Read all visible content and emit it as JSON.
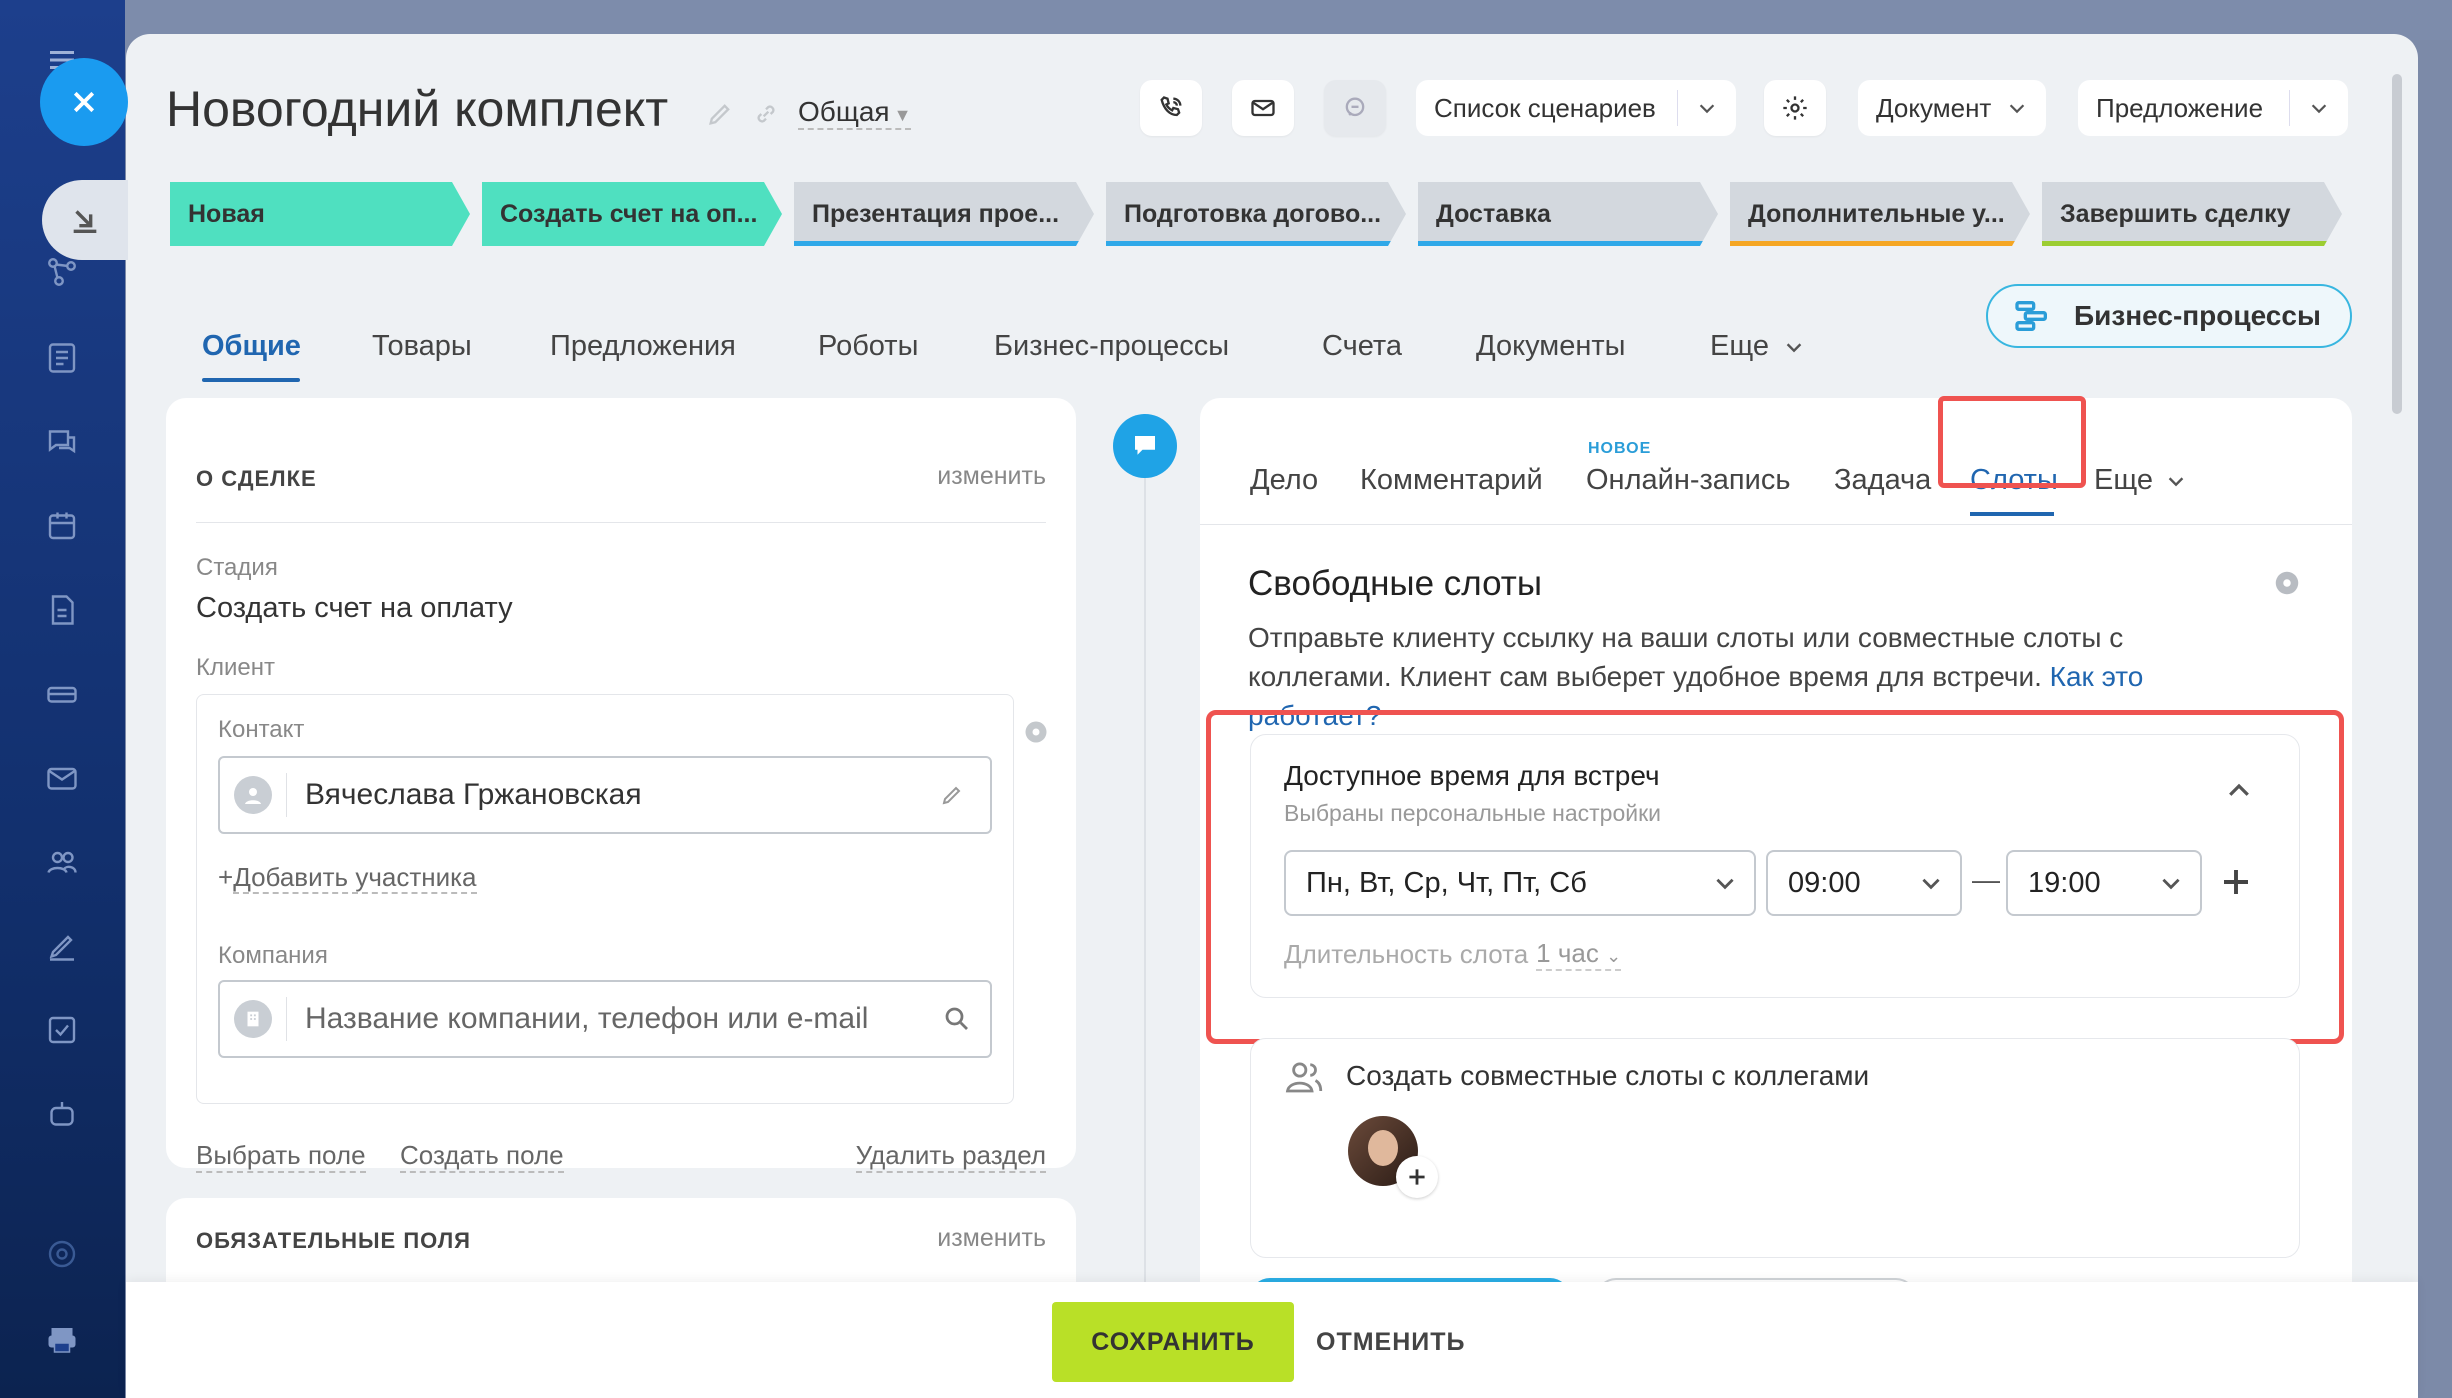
{
  "deal": {
    "title": "Новогодний комплект",
    "category": "Общая"
  },
  "header_buttons": {
    "scenarios": "Список сценариев",
    "document": "Документ",
    "proposal": "Предложение"
  },
  "stages": [
    {
      "label": "Новая",
      "state": "done",
      "color": "#4fe0c0"
    },
    {
      "label": "Создать счет на оп...",
      "state": "done",
      "color": "#4fe0c0"
    },
    {
      "label": "Презентация прое...",
      "state": "todo",
      "color": "#2fa8e8"
    },
    {
      "label": "Подготовка догово...",
      "state": "todo",
      "color": "#2fa8e8"
    },
    {
      "label": "Доставка",
      "state": "todo",
      "color": "#2fa8e8"
    },
    {
      "label": "Дополнительные у...",
      "state": "todo",
      "color": "#f5a623"
    },
    {
      "label": "Завершить сделку",
      "state": "todo",
      "color": "#9ccd32"
    }
  ],
  "tabs": [
    "Общие",
    "Товары",
    "Предложения",
    "Роботы",
    "Бизнес-процессы",
    "Счета",
    "Документы",
    "Еще"
  ],
  "bp_button": "Бизнес-процессы",
  "about": {
    "header": "О СДЕЛКЕ",
    "edit": "изменить",
    "stage_label": "Стадия",
    "stage_value": "Создать счет на оплату",
    "client_label": "Клиент",
    "contact_label": "Контакт",
    "contact_value": "Вячеслава Гржановская",
    "add_participant": "Добавить участника",
    "company_label": "Компания",
    "company_placeholder": "Название компании, телефон или e-mail",
    "choose_field": "Выбрать поле",
    "create_field": "Создать поле",
    "delete_section": "Удалить раздел"
  },
  "required": {
    "header": "ОБЯЗАТЕЛЬНЫЕ ПОЛЯ",
    "edit": "изменить"
  },
  "timeline_tabs": {
    "task": "Дело",
    "comment": "Комментарий",
    "new_badge": "НОВОЕ",
    "booking": "Онлайн-запись",
    "todo": "Задача",
    "slots": "Слоты",
    "more": "Еще"
  },
  "slots": {
    "title": "Свободные слоты",
    "desc": "Отправьте клиенту ссылку на ваши слоты или совместные слоты с коллегами. Клиент сам выберет удобное время для встречи.",
    "help_link": "Как это работает?",
    "available_title": "Доступное время для встреч",
    "available_sub": "Выбраны персональные настройки",
    "days": "Пн, Вт, Ср, Чт, Пт, Сб",
    "from": "09:00",
    "dash": "—",
    "to": "19:00",
    "duration_label": "Длительность слота",
    "duration_value": "1 час",
    "colleagues": "Создать совместные слоты с коллегами"
  },
  "footer": {
    "save": "СОХРАНИТЬ",
    "cancel": "ОТМЕНИТЬ"
  }
}
